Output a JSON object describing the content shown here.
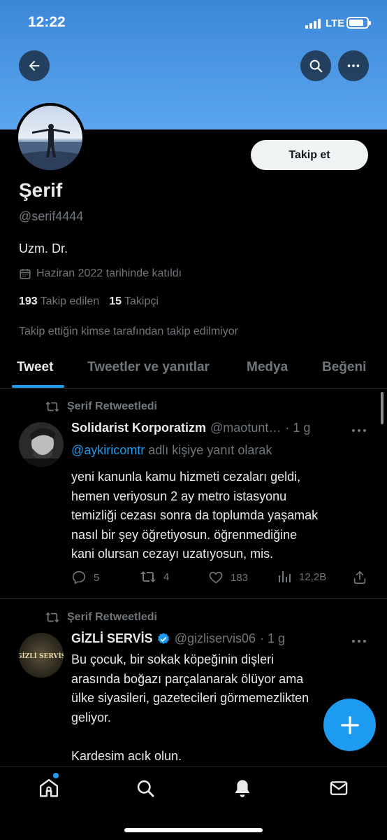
{
  "status_bar": {
    "time": "12:22",
    "network": "LTE"
  },
  "colors": {
    "accent": "#1d9bf0",
    "banner": "#4f9ae6",
    "background": "#000000",
    "muted": "#71767b"
  },
  "profile": {
    "display_name": "Şerif",
    "handle": "@serif4444",
    "bio": "Uzm. Dr.",
    "joined": "Haziran 2022 tarihinde katıldı",
    "following_count": "193",
    "following_label": "Takip edilen",
    "followers_count": "15",
    "followers_label": "Takipçi",
    "followers_note": "Takip ettiğin kimse tarafından takip edilmiyor",
    "follow_button": "Takip et"
  },
  "tabs": [
    {
      "label": "Tweet",
      "active": true
    },
    {
      "label": "Tweetler ve yanıtlar",
      "active": false
    },
    {
      "label": "Medya",
      "active": false
    },
    {
      "label": "Beğeni",
      "active": false
    }
  ],
  "tweets": [
    {
      "retweet_label": "Şerif Retweetledi",
      "author_name": "Solidarist Korporatizm",
      "author_handle": "@maotunt…",
      "time": "· 1 g",
      "reply_link": "@aykiricomtr",
      "reply_text": " adlı kişiye yanıt olarak",
      "body": "yeni kanunla kamu hizmeti cezaları geldi,\nhemen veriyosun 2 ay metro istasyonu\ntemizliği cezası sonra da toplumda yaşamak\nnasıl bir şey öğretiyosun. öğrenmediğine\nkani olursan cezayı uzatıyosun, mis.",
      "replies": "5",
      "retweets": "4",
      "likes": "183",
      "views": "12,2B"
    },
    {
      "retweet_label": "Şerif Retweetledi",
      "author_name": "GİZLİ SERVİS",
      "author_handle": "@gizliservis06",
      "time": "· 1 g",
      "avatar_text": "GİZLİ SERVİS",
      "body": "Bu çocuk, bir sokak köpeğinin dişleri\narasında boğazı parçalanarak ölüyor ama\nülke siyasileri, gazetecileri görmemezlikten\ngeliyor.\n\nKardesim acık olun."
    }
  ],
  "icons": {
    "back": "arrow-left-icon",
    "search": "search-icon",
    "more": "more-horizontal-icon",
    "calendar": "calendar-icon",
    "retweet": "retweet-icon",
    "reply": "reply-icon",
    "like": "heart-icon",
    "views": "views-icon",
    "share": "share-icon",
    "compose": "plus-icon",
    "home": "home-icon",
    "explore": "search-icon",
    "notifications": "bell-icon",
    "messages": "mail-icon"
  }
}
